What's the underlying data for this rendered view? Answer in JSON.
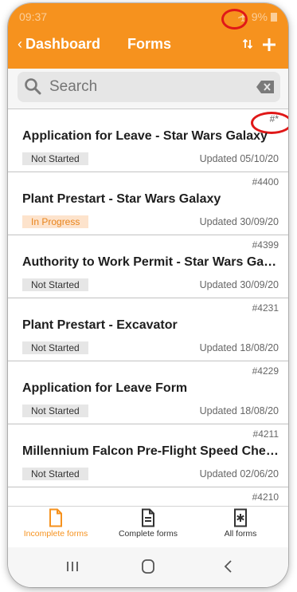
{
  "status": {
    "time": "09:37",
    "battery": "9%"
  },
  "header": {
    "back_label": "Dashboard",
    "title": "Forms"
  },
  "search": {
    "placeholder": "Search"
  },
  "forms": [
    {
      "number": "#*",
      "title": "Application for Leave - Star Wars Galaxy",
      "status": "Not Started",
      "updated": "Updated 05/10/20"
    },
    {
      "number": "#4400",
      "title": "Plant Prestart - Star Wars Galaxy",
      "status": "In Progress",
      "updated": "Updated 30/09/20"
    },
    {
      "number": "#4399",
      "title": "Authority to Work Permit - Star Wars Galaxy",
      "status": "Not Started",
      "updated": "Updated 30/09/20"
    },
    {
      "number": "#4231",
      "title": "Plant Prestart - Excavator",
      "status": "Not Started",
      "updated": "Updated 18/08/20"
    },
    {
      "number": "#4229",
      "title": "Application for Leave Form",
      "status": "Not Started",
      "updated": "Updated 18/08/20"
    },
    {
      "number": "#4211",
      "title": "Millennium Falcon Pre-Flight Speed Chec...",
      "status": "Not Started",
      "updated": "Updated 02/06/20"
    },
    {
      "number": "#4210",
      "title": "",
      "status": "",
      "updated": ""
    }
  ],
  "tabs": [
    {
      "label": "Incomplete forms",
      "active": true
    },
    {
      "label": "Complete forms",
      "active": false
    },
    {
      "label": "All forms",
      "active": false
    }
  ],
  "colors": {
    "accent": "#f6921e",
    "annotation": "#e01818"
  }
}
